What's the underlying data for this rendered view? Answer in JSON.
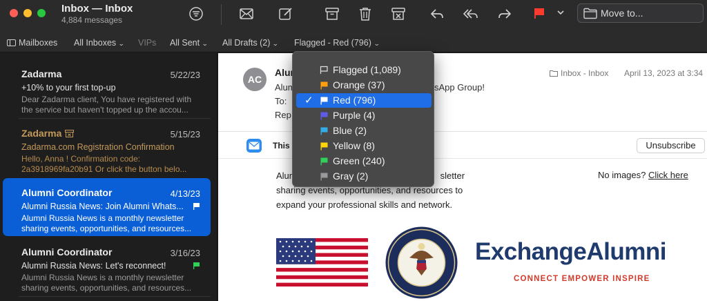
{
  "window": {
    "title": "Inbox — Inbox",
    "subtitle": "4,884 messages"
  },
  "toolbar": {
    "icons": [
      "filter-icon",
      "compose-icon",
      "new-message-icon",
      "archive-icon",
      "trash-icon",
      "junk-icon",
      "reply-icon",
      "reply-all-icon",
      "forward-icon",
      "flag-icon",
      "chevron-down-icon",
      "folder-icon"
    ],
    "move_to": "Move to...",
    "flag_color": "#ff3b30"
  },
  "favorites": {
    "mailboxes": "Mailboxes",
    "all_inboxes": "All Inboxes",
    "vips": "VIPs",
    "all_sent": "All Sent",
    "all_drafts": "All Drafts (2)",
    "flagged": "Flagged - Red (796)"
  },
  "messages": [
    {
      "from": "Zadarma",
      "date": "5/22/23",
      "subject": "+10% to your first top-up",
      "preview1": "Dear Zadarma client, You have registered with",
      "preview2": "the service but haven't topped up the accou..."
    },
    {
      "from": "Zadarma",
      "date": "5/15/23",
      "subject": "Zadarma.com Registration Confirmation",
      "preview1": "Hello, Anna ! Confirmation code:",
      "preview2": "2a3918969fa20b91 Or click the button belo..."
    },
    {
      "from": "Alumni Coordinator",
      "date": "4/13/23",
      "subject": "Alumni Russia News: Join Alumni Whats...",
      "preview1": "Alumni Russia News is a monthly newsletter",
      "preview2": "sharing events, opportunities, and resources..."
    },
    {
      "from": "Alumni Coordinator",
      "date": "3/16/23",
      "subject": "Alumni Russia News: Let's reconnect!",
      "preview1": "Alumni Russia News is a monthly newsletter",
      "preview2": "sharing events, opportunities, and resources..."
    }
  ],
  "reader": {
    "avatar": "AC",
    "from": "Alum",
    "subject_head": "Alum",
    "subject_tail": "sApp Group!",
    "to": "To:",
    "reply": "Rep",
    "mailbox": "Inbox - Inbox",
    "date": "April 13, 2023 at 3:34",
    "banner": "This",
    "unsubscribe": "Unsubscribe",
    "body_line1_head": "Alum",
    "body_line1_tail": "sletter",
    "body_line2": "sharing events, opportunities, and resources to",
    "body_line3": "expand your professional skills and network.",
    "no_images": "No images?",
    "click_here": "Click here",
    "brand": "ExchangeAlumni",
    "tagline": "CONNECT EMPOWER INSPIRE"
  },
  "flag_menu": {
    "items": [
      {
        "label": "Flagged (1,089)",
        "color": "outline"
      },
      {
        "label": "Orange (37)",
        "color": "#ff9f0a"
      },
      {
        "label": "Red (796)",
        "color": "#ffffff",
        "checked": true
      },
      {
        "label": "Purple (4)",
        "color": "#5e5ce6"
      },
      {
        "label": "Blue (2)",
        "color": "#32ade6"
      },
      {
        "label": "Yellow (8)",
        "color": "#ffd60a"
      },
      {
        "label": "Green (240)",
        "color": "#30d158"
      },
      {
        "label": "Gray (2)",
        "color": "#98989d"
      }
    ],
    "check": "✓"
  }
}
